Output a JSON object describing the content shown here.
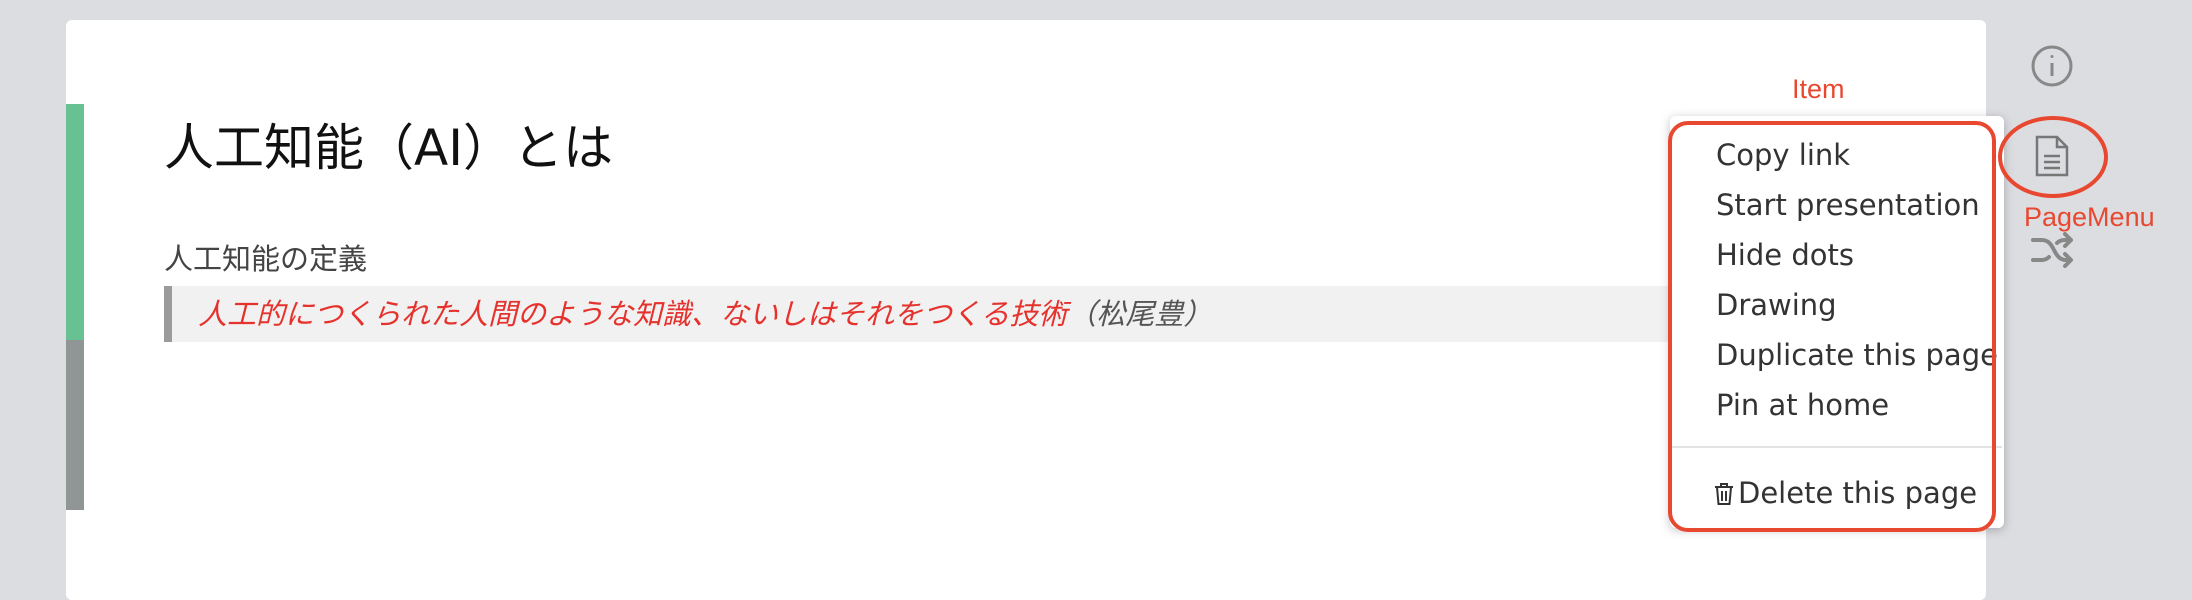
{
  "page": {
    "title": "人工知能（AI）とは",
    "subtitle": "人工知能の定義",
    "quote": {
      "text_red": "人工的につくられた人間のような知識、ないしはそれをつくる技術",
      "text_attribution": "（松尾豊）"
    }
  },
  "page_menu": {
    "items": [
      {
        "label": "Copy link"
      },
      {
        "label": "Start presentation"
      },
      {
        "label": "Hide dots"
      },
      {
        "label": "Drawing"
      },
      {
        "label": "Duplicate this page"
      },
      {
        "label": "Pin at home"
      }
    ],
    "delete_label": "Delete this page"
  },
  "annotations": {
    "item_label": "Item",
    "pagemenu_label": "PageMenu"
  },
  "colors": {
    "accent_green": "#67c193",
    "annotation_red": "#e84830",
    "quote_red": "#e5322d"
  },
  "icons": [
    "info-icon",
    "page-icon",
    "shuffle-icon",
    "trash-icon"
  ]
}
